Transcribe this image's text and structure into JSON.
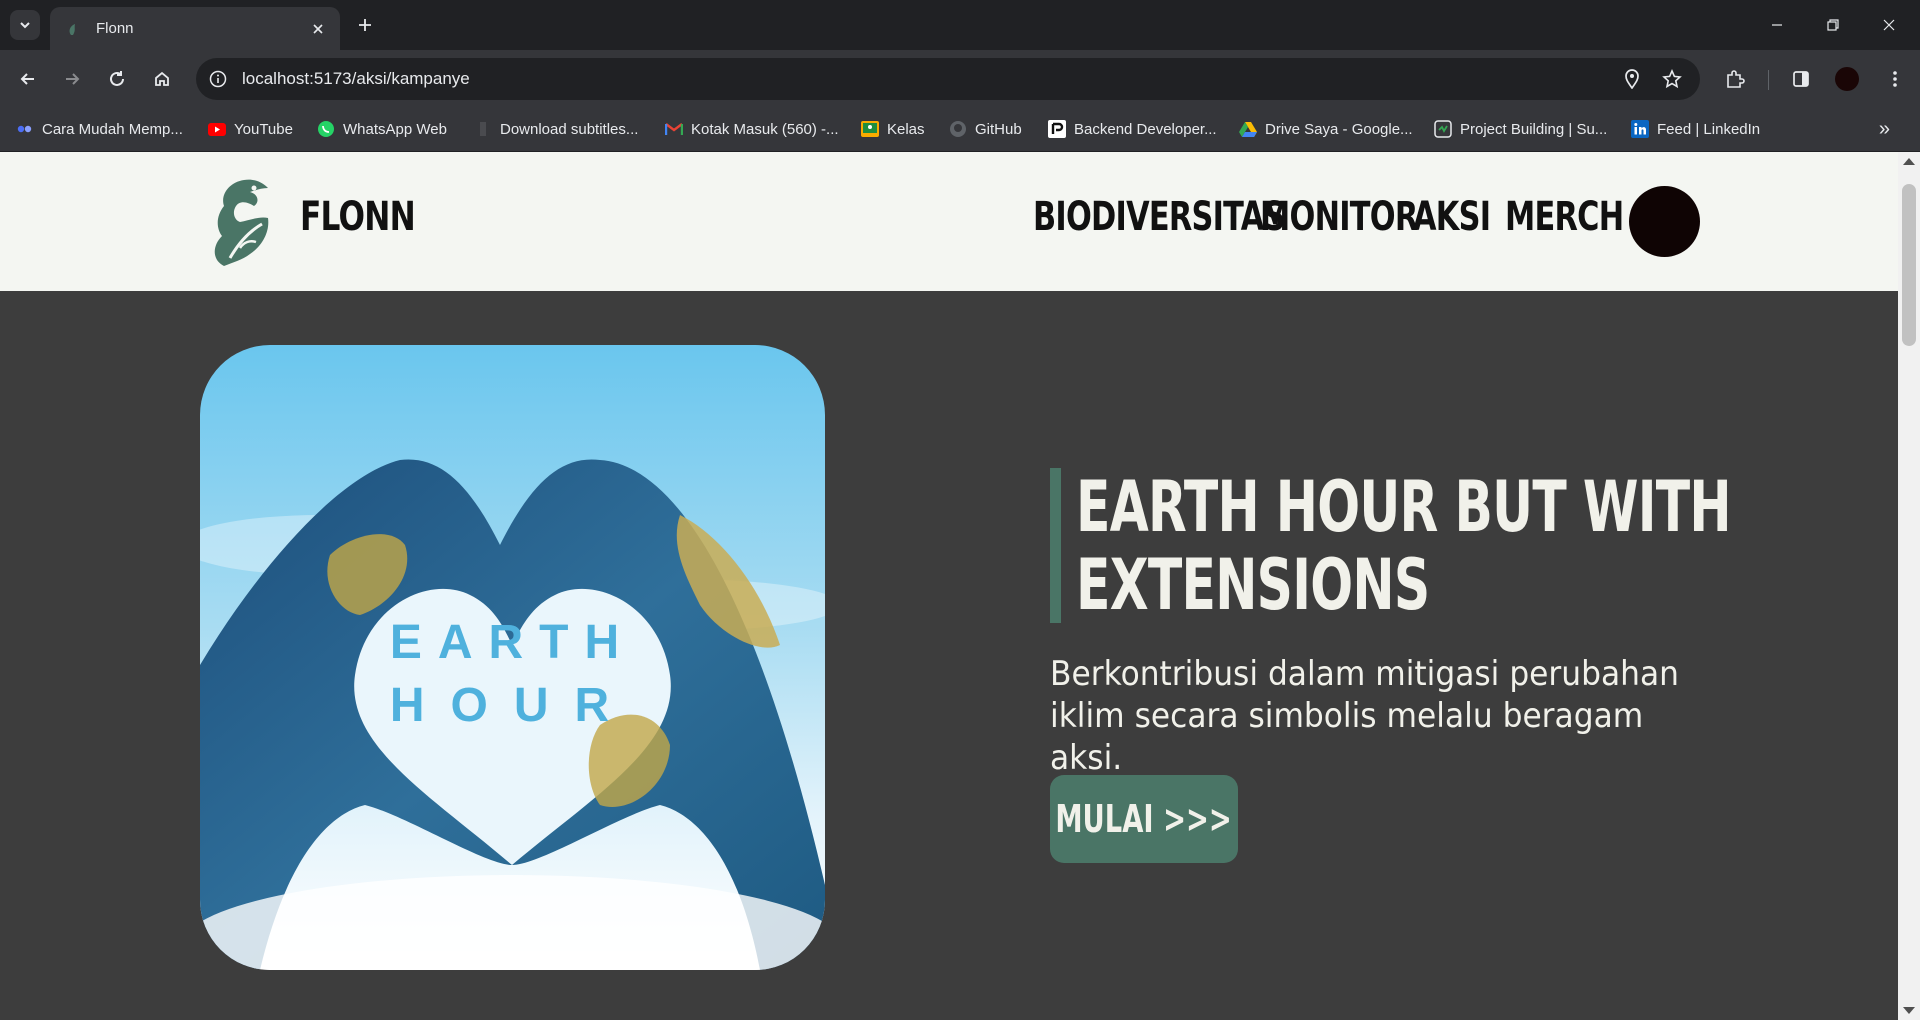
{
  "browser": {
    "tab_title": "Flonn",
    "url": "localhost:5173/aksi/kampanye",
    "bookmarks": [
      {
        "label": "Cara Mudah Memp...",
        "icon": "link-icon"
      },
      {
        "label": "YouTube",
        "icon": "youtube-icon"
      },
      {
        "label": "WhatsApp Web",
        "icon": "whatsapp-icon"
      },
      {
        "label": "Download subtitles...",
        "icon": "bookmark-icon"
      },
      {
        "label": "Kotak Masuk (560) -...",
        "icon": "gmail-icon"
      },
      {
        "label": "Kelas",
        "icon": "classroom-icon"
      },
      {
        "label": "GitHub",
        "icon": "github-icon"
      },
      {
        "label": "Backend Developer...",
        "icon": "dicoding-icon"
      },
      {
        "label": "Drive Saya - Google...",
        "icon": "drive-icon"
      },
      {
        "label": "Project Building | Su...",
        "icon": "project-icon"
      },
      {
        "label": "Feed | LinkedIn",
        "icon": "linkedin-icon"
      }
    ]
  },
  "site": {
    "brand": "FLONN",
    "nav": [
      "BIODIVERSITAS",
      "MONITOR",
      "AKSI",
      "MERCH"
    ]
  },
  "hero": {
    "image_text_line1": "EARTH",
    "image_text_line2": "HOUR",
    "title_line1": "EARTH HOUR BUT WITH",
    "title_line2": "EXTENSIONS",
    "description_line1": "Berkontribusi dalam mitigasi perubahan",
    "description_line2": "iklim secara simbolis melalu beragam aksi.",
    "cta_label": "MULAI >>>"
  },
  "colors": {
    "accent": "#4a7566",
    "page_bg": "#3d3d3d",
    "header_bg": "#f4f6f2",
    "text_light": "#f1f1ea"
  }
}
